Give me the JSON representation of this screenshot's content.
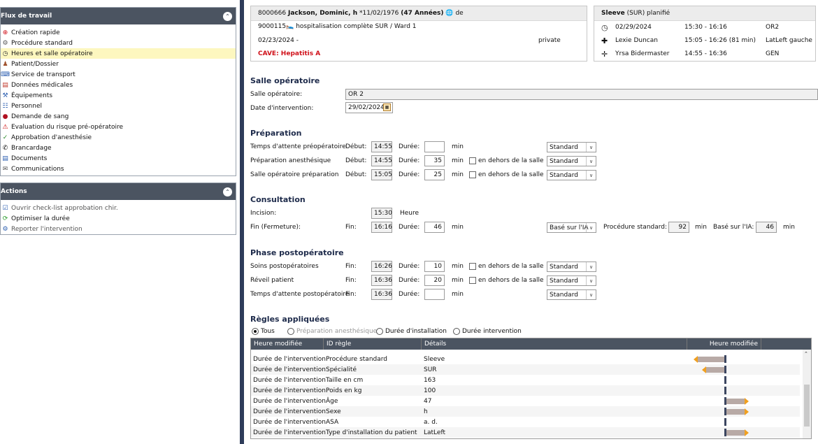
{
  "workflow": {
    "title": "Flux de travail",
    "items": [
      {
        "label": "Création rapide",
        "icon": "plus-circle-icon"
      },
      {
        "label": "Procédure standard",
        "icon": "gear-icon"
      },
      {
        "label": "Heures et salle opératoire",
        "icon": "clock-icon",
        "selected": true
      },
      {
        "label": "Patient/Dossier",
        "icon": "person-icon"
      },
      {
        "label": "Service de transport",
        "icon": "transport-icon"
      },
      {
        "label": "Données médicales",
        "icon": "medical-data-icon"
      },
      {
        "label": "Équipements",
        "icon": "equipment-icon"
      },
      {
        "label": "Personnel",
        "icon": "staff-icon"
      },
      {
        "label": "Demande de sang",
        "icon": "blood-drop-icon"
      },
      {
        "label": "Evaluation du risque pré-opératoire",
        "icon": "warning-icon"
      },
      {
        "label": "Approbation d'anesthésie",
        "icon": "anesthesia-approval-icon"
      },
      {
        "label": "Brancardage",
        "icon": "phone-icon"
      },
      {
        "label": "Documents",
        "icon": "documents-icon"
      },
      {
        "label": "Communications",
        "icon": "mail-icon"
      }
    ]
  },
  "actions": {
    "title": "Actions",
    "items": [
      {
        "label": "Ouvrir check-list approbation chir.",
        "icon": "checklist-icon",
        "enabled": false
      },
      {
        "label": "Optimiser la durée",
        "icon": "refresh-icon",
        "enabled": true
      },
      {
        "label": "Reporter l'intervention",
        "icon": "postpone-icon",
        "enabled": false
      }
    ]
  },
  "patient": {
    "id": "8000666",
    "name": "Jackson, Dominic, h",
    "dob": "*11/02/1976",
    "age": "(47 Années)",
    "lang": "de",
    "case": "9000115",
    "stay": "hospitalisation complète SUR / Ward 1",
    "date": "02/23/2024 -",
    "insurance": "private",
    "cave": "CAVE: Hepatitis A"
  },
  "procedure": {
    "name": "Sleeve",
    "rest": "(SUR) planifié",
    "rows": [
      {
        "icon": "clock-icon",
        "who": "02/29/2024",
        "time": "15:30 - 16:16",
        "extra": "OR2"
      },
      {
        "icon": "surgeon-icon",
        "who": "Lexie Duncan",
        "time": "15:05 - 16:26 (81 min)",
        "extra": "LatLeft gauche"
      },
      {
        "icon": "anesthetist-icon",
        "who": "Yrsa Bidermaster",
        "time": "14:55 - 16:36",
        "extra": "GEN"
      }
    ]
  },
  "room": {
    "section": "Salle opératoire",
    "room_label": "Salle opératoire:",
    "room_value": "OR 2",
    "date_label": "Date d'intervention:",
    "date_value": "29/02/2024"
  },
  "common": {
    "debut": "Début:",
    "fin": "Fin:",
    "duree": "Durée:",
    "min": "min",
    "outside": "en dehors de la salle",
    "standard": "Standard"
  },
  "prep": {
    "section": "Préparation",
    "rows": [
      {
        "label": "Temps d'attente préopératoire",
        "time": "14:55",
        "duration": ""
      },
      {
        "label": "Préparation anesthésique",
        "time": "14:55",
        "duration": "35"
      },
      {
        "label": "Salle opératoire préparation",
        "time": "15:05",
        "duration": "25"
      }
    ]
  },
  "consult": {
    "section": "Consultation",
    "incision_label": "Incision:",
    "incision_time": "15:30",
    "heure": "Heure",
    "fin_label": "Fin (Fermeture):",
    "fin_time": "16:16",
    "duration": "46",
    "basis": "Basé sur l'IA",
    "std_label": "Procédure standard:",
    "std_value": "92",
    "ia_label": "Basé sur l'IA:",
    "ia_value": "46"
  },
  "post": {
    "section": "Phase postopératoire",
    "rows": [
      {
        "label": "Soins postopératoires",
        "time": "16:26",
        "duration": "10"
      },
      {
        "label": "Réveil patient",
        "time": "16:36",
        "duration": "20"
      },
      {
        "label": "Temps d'attente postopératoire",
        "time": "16:36",
        "duration": ""
      }
    ]
  },
  "rules": {
    "section": "Règles appliquées",
    "filters": [
      "Tous",
      "Préparation anesthésique",
      "Durée d'installation",
      "Durée intervention"
    ],
    "columns": [
      "Heure modifiée",
      "ID règle",
      "Détails",
      "Heure modifiée"
    ],
    "rows": [
      {
        "a": "Durée de l'intervention",
        "b": "Procédure standard",
        "c": "Sleeve",
        "dir": "left"
      },
      {
        "a": "Durée de l'intervention",
        "b": "Spécialité",
        "c": "SUR",
        "dir": "left"
      },
      {
        "a": "Durée de l'intervention",
        "b": "Taille en cm",
        "c": "163",
        "dir": ""
      },
      {
        "a": "Durée de l'intervention",
        "b": "Poids en kg",
        "c": "100",
        "dir": ""
      },
      {
        "a": "Durée de l'intervention",
        "b": "Âge",
        "c": "47",
        "dir": "right"
      },
      {
        "a": "Durée de l'intervention",
        "b": "Sexe",
        "c": "h",
        "dir": "right"
      },
      {
        "a": "Durée de l'intervention",
        "b": "ASA",
        "c": "a. d.",
        "dir": ""
      },
      {
        "a": "Durée de l'intervention",
        "b": "Type d'installation du patient",
        "c": "LatLeft",
        "dir": "right"
      }
    ]
  }
}
